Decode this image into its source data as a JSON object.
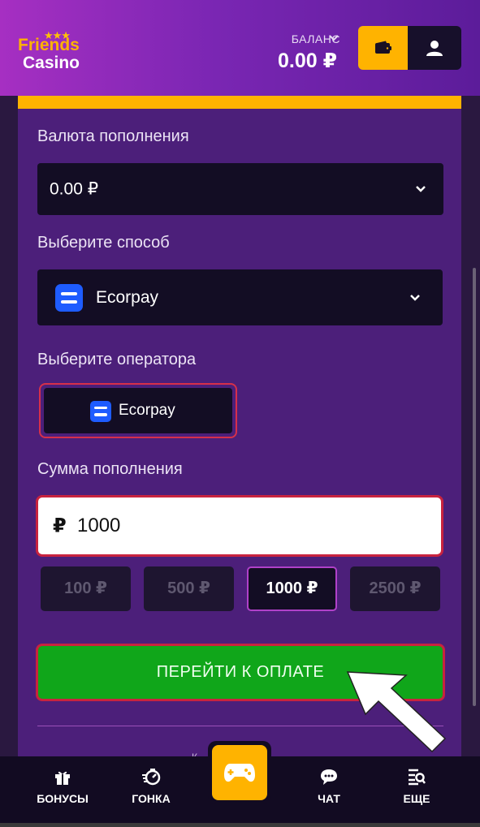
{
  "header": {
    "logo_line1": "Friends",
    "logo_line2": "Casino",
    "balance_label": "БАЛАНС",
    "balance_value": "0.00 ₽"
  },
  "form": {
    "currency_label": "Валюта пополнения",
    "currency_value": "0.00 ₽",
    "method_label": "Выберите способ",
    "method_value": "Ecorpay",
    "operator_label": "Выберите оператора",
    "operator_value": "Ecorpay",
    "amount_label": "Сумма пополнения",
    "amount_currency": "₽",
    "amount_value": "1000",
    "presets": [
      "100 ₽",
      "500 ₽",
      "1000 ₽",
      "2500 ₽"
    ],
    "selected_preset": "1000 ₽",
    "submit_label": "ПЕРЕЙТИ К ОПЛАТЕ",
    "footer_partial": "К...  ...%"
  },
  "nav": {
    "items": [
      {
        "label": "БОНУСЫ",
        "icon": "gift-icon"
      },
      {
        "label": "ГОНКА",
        "icon": "race-icon"
      },
      {
        "label": "ЧАТ",
        "icon": "chat-icon"
      },
      {
        "label": "ЕЩЕ",
        "icon": "more-icon"
      }
    ],
    "center_icon": "gamepad-icon"
  },
  "colors": {
    "accent_gold": "#ffb300",
    "panel": "#4c1f7a",
    "submit_green": "#10a61a",
    "highlight_red": "#c8233f"
  }
}
